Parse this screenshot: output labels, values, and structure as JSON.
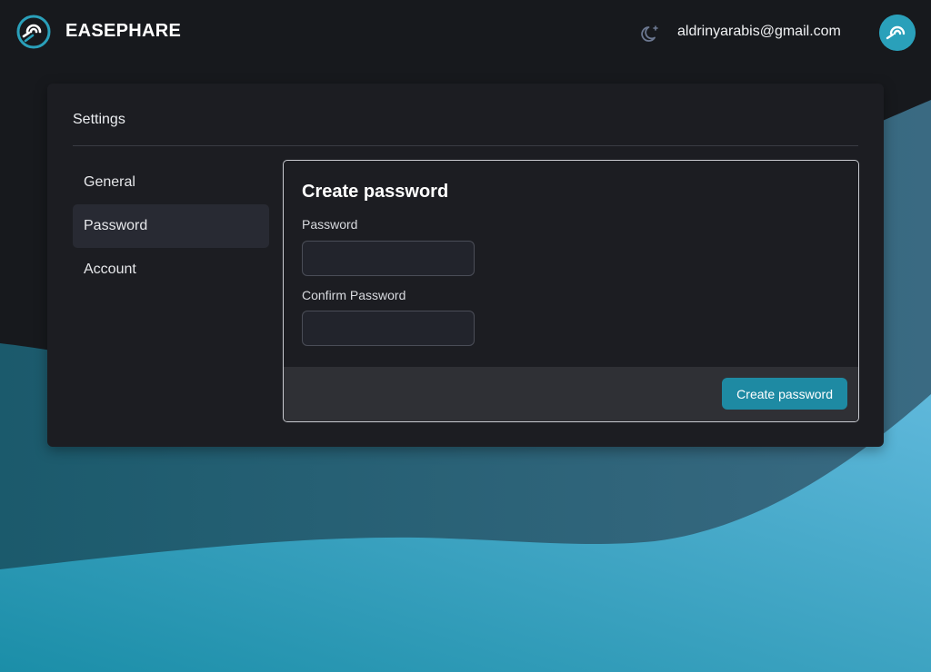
{
  "header": {
    "brand": "EASEPHARE",
    "user_email": "aldrinyarabis@gmail.com",
    "theme_icon": "moon-star-icon",
    "logo_icon": "easephare-logo-icon"
  },
  "settings": {
    "title": "Settings",
    "sidebar": {
      "items": [
        {
          "label": "General",
          "active": false
        },
        {
          "label": "Password",
          "active": true
        },
        {
          "label": "Account",
          "active": false
        }
      ]
    },
    "password_panel": {
      "title": "Create password",
      "password_label": "Password",
      "password_value": "",
      "confirm_label": "Confirm Password",
      "confirm_value": "",
      "submit_label": "Create password"
    }
  },
  "colors": {
    "accent": "#1e8aa3",
    "background": "#17191d",
    "card": "#1c1d22",
    "wave_light": "#5ab4d8",
    "wave_dark": "#1a5468"
  }
}
